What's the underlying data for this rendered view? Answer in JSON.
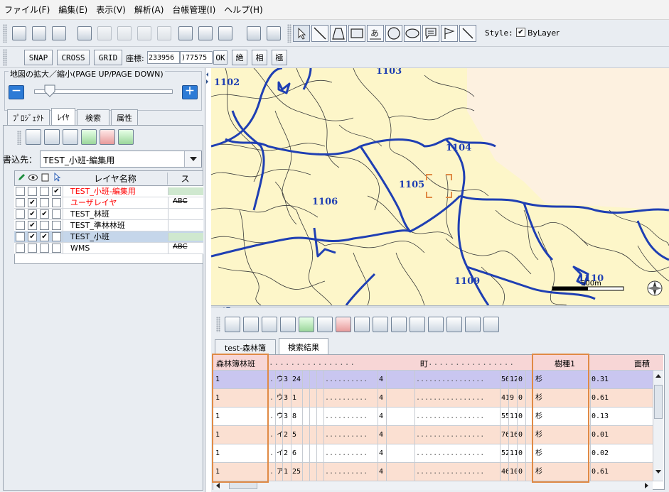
{
  "menu": [
    "ファイル(F)",
    "編集(E)",
    "表示(V)",
    "解析(A)",
    "台帳管理(I)",
    "ヘルプ(H)"
  ],
  "toolbar": {
    "style_label": "Style:",
    "bylayer_label": "ByLayer",
    "bylayer_checked": "✔"
  },
  "snapbar": {
    "snap": "SNAP",
    "cross": "CROSS",
    "grid": "GRID",
    "coord_label": "座標:",
    "coord_x": "233956",
    "coord_y": ")77575",
    "ok": "OK",
    "abs": "絶",
    "rel": "相",
    "polar": "極"
  },
  "zoom": {
    "label": "地図の拡大／縮小(PAGE UP/PAGE DOWN)",
    "minus": "－",
    "plus": "＋",
    "level": 0.05
  },
  "left_tabs": [
    "ﾌﾟﾛｼﾞｪｸﾄ",
    "ﾚｲﾔ",
    "検索",
    "属性"
  ],
  "active_left_tab": "ﾚｲﾔ",
  "write_target": {
    "label": "書込先：",
    "value": "TEST_小班-編集用"
  },
  "layer_table": {
    "col_name": "レイヤ名称",
    "col_style": "ス",
    "rows": [
      {
        "name": "TEST_小班-編集用",
        "color": "#ff0000",
        "c1": "",
        "c2": "",
        "c3": "",
        "c4": "✔",
        "style": "green",
        "style_text": ""
      },
      {
        "name": "ユーザレイヤ",
        "color": "#ff0000",
        "c1": "",
        "c2": "✔",
        "c3": "",
        "c4": "",
        "style": "abc",
        "style_text": "ABC"
      },
      {
        "name": "TEST_林班",
        "color": "#000000",
        "c1": "",
        "c2": "✔",
        "c3": "✔",
        "c4": "",
        "style": "white",
        "style_text": ""
      },
      {
        "name": "TEST_準林林班",
        "color": "#000000",
        "c1": "",
        "c2": "✔",
        "c3": "",
        "c4": "",
        "style": "white",
        "style_text": ""
      },
      {
        "name": "TEST_小班",
        "color": "#000000",
        "c1": "",
        "c2": "✔",
        "c3": "✔",
        "c4": "",
        "style": "green",
        "style_text": ""
      },
      {
        "name": "WMS",
        "color": "#000000",
        "c1": "",
        "c2": "",
        "c3": "",
        "c4": "",
        "style": "abc",
        "style_text": "ABC"
      }
    ]
  },
  "map": {
    "labels": [
      "1102",
      "1104",
      "1105",
      "1106",
      "1109",
      "1110"
    ],
    "scale_label": "500m",
    "partial_label": "1103"
  },
  "result_tabs": [
    "test-森林簿",
    "検索結果"
  ],
  "active_result_tab": "検索結果",
  "grid": {
    "header_first": "森林簿林班",
    "header_cho": "町",
    "header_species": "樹種1",
    "header_area": "面積",
    "rows": [
      {
        "rinpan": "1",
        "aza": "ウ",
        "c1": "3",
        "c2": "24",
        "c3": "4",
        "c4": "56",
        "c5": "12",
        "c6": "0",
        "species": "杉",
        "area": "0.31",
        "bg": "#c9c6f0"
      },
      {
        "rinpan": "1",
        "aza": "ウ",
        "c1": "3",
        "c2": "1",
        "c3": "4",
        "c4": "41",
        "c5": "9",
        "c6": "0",
        "species": "杉",
        "area": "0.61",
        "bg": "#fbe0d2"
      },
      {
        "rinpan": "1",
        "aza": "ウ",
        "c1": "3",
        "c2": "8",
        "c3": "4",
        "c4": "55",
        "c5": "11",
        "c6": "0",
        "species": "杉",
        "area": "0.13",
        "bg": "#ffffff"
      },
      {
        "rinpan": "1",
        "aza": "イ",
        "c1": "2",
        "c2": "5",
        "c3": "4",
        "c4": "76",
        "c5": "16",
        "c6": "0",
        "species": "杉",
        "area": "0.01",
        "bg": "#fbe0d2"
      },
      {
        "rinpan": "1",
        "aza": "イ",
        "c1": "2",
        "c2": "6",
        "c3": "4",
        "c4": "52",
        "c5": "11",
        "c6": "0",
        "species": "杉",
        "area": "0.02",
        "bg": "#ffffff"
      },
      {
        "rinpan": "1",
        "aza": "ア",
        "c1": "1",
        "c2": "25",
        "c3": "4",
        "c4": "46",
        "c5": "10",
        "c6": "0",
        "species": "杉",
        "area": "0.61",
        "bg": "#fbe0d2"
      }
    ]
  },
  "colors": {
    "map_fill": "#fdf6c9",
    "boundary": "#1f3fb3",
    "highlight": "#e08a45",
    "selected_row": "#c9c6f0",
    "alt_row": "#fbe0d2"
  }
}
